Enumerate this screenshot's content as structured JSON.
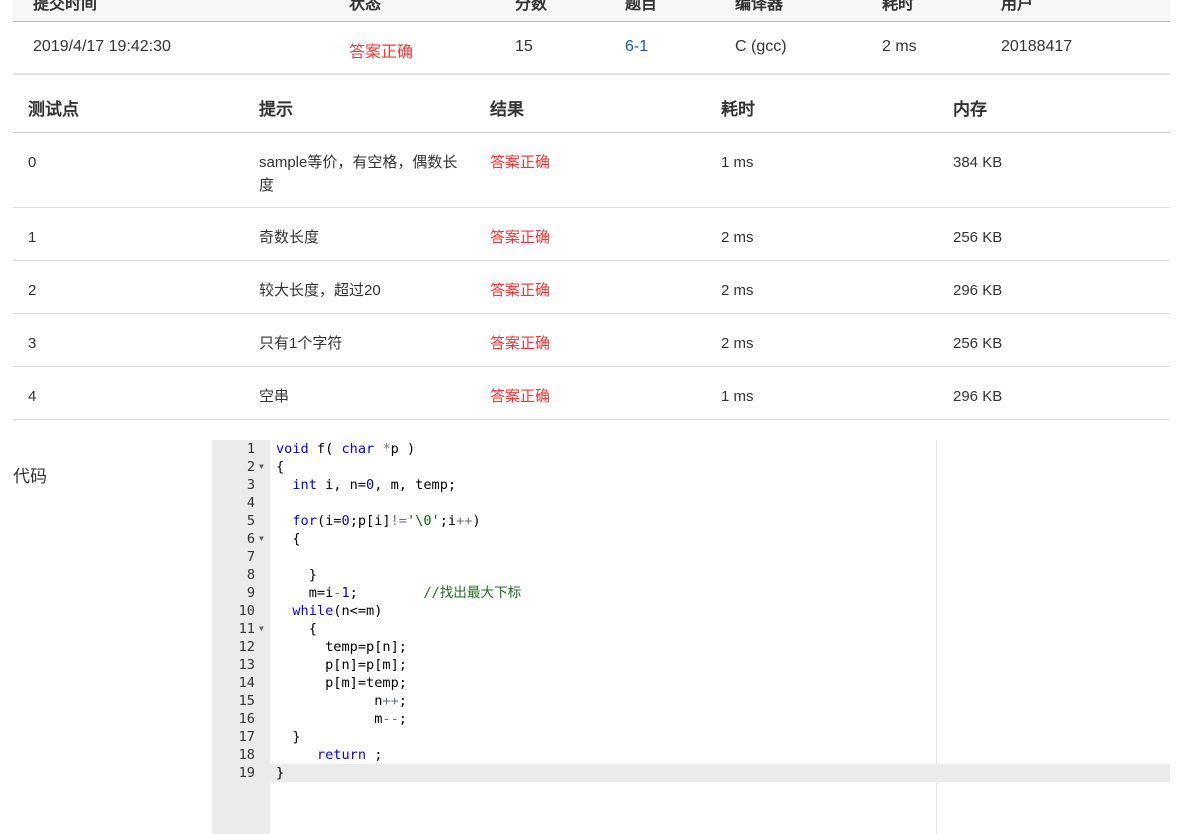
{
  "submission": {
    "headers": [
      "提交时间",
      "状态",
      "分数",
      "题目",
      "编译器",
      "耗时",
      "用户"
    ],
    "row": {
      "time": "2019/4/17 19:42:30",
      "status": "答案正确",
      "score": "15",
      "problem": "6-1",
      "compiler": "C (gcc)",
      "elapsed": "2 ms",
      "user": "20188417"
    }
  },
  "tests": {
    "headers": [
      "测试点",
      "提示",
      "结果",
      "耗时",
      "内存"
    ],
    "rows": [
      {
        "id": "0",
        "hint": "sample等价，有空格，偶数长度",
        "result": "答案正确",
        "time": "1 ms",
        "memory": "384 KB"
      },
      {
        "id": "1",
        "hint": "奇数长度",
        "result": "答案正确",
        "time": "2 ms",
        "memory": "256 KB"
      },
      {
        "id": "2",
        "hint": "较大长度，超过20",
        "result": "答案正确",
        "time": "2 ms",
        "memory": "296 KB"
      },
      {
        "id": "3",
        "hint": "只有1个字符",
        "result": "答案正确",
        "time": "2 ms",
        "memory": "256 KB"
      },
      {
        "id": "4",
        "hint": "空串",
        "result": "答案正确",
        "time": "1 ms",
        "memory": "296 KB"
      }
    ]
  },
  "code_label": "代码",
  "code": {
    "lines": [
      "void f( char *p )",
      "{",
      "  int i, n=0, m, temp;",
      "",
      "  for(i=0;p[i]!='\\0';i++)",
      "  {",
      "",
      "    }",
      "    m=i-1;        //找出最大下标",
      "  while(n<=m)",
      "    {",
      "      temp=p[n];",
      "      p[n]=p[m];",
      "      p[m]=temp;",
      "            n++;",
      "            m--;",
      "  }",
      "     return ;",
      "}"
    ],
    "fold_lines": [
      2,
      6,
      11
    ],
    "active_line": 19,
    "colors": {
      "keyword": "#0000ff",
      "number": "#0000cd",
      "string": "#036a07",
      "comment": "#236e24"
    }
  }
}
